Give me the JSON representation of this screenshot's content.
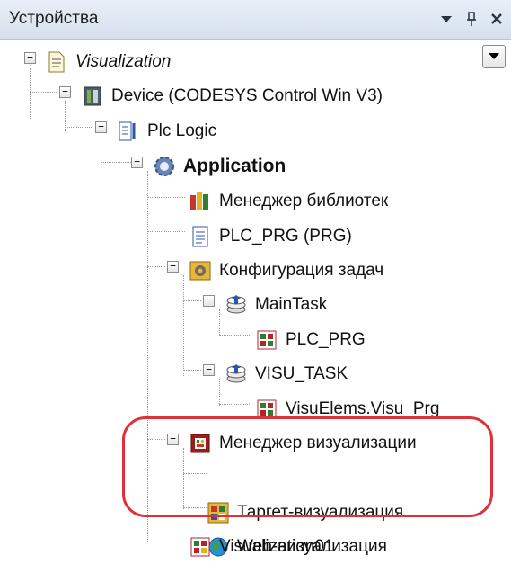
{
  "panel": {
    "title": "Устройства"
  },
  "tree": {
    "root": "Visualization",
    "device": "Device (CODESYS Control Win V3)",
    "plc_logic": "Plc Logic",
    "application": "Application",
    "library_manager": "Менеджер библиотек",
    "plc_prg": "PLC_PRG (PRG)",
    "task_config": "Конфигурация задач",
    "main_task": "MainTask",
    "main_task_call": "PLC_PRG",
    "visu_task": "VISU_TASK",
    "visu_task_call": "VisuElems.Visu_Prg",
    "visu_manager": "Менеджер визуализации",
    "target_visu": "Таргет-визуализация",
    "web_visu": "Web-визуализация",
    "visualization01": "Visualization01"
  },
  "colors": {
    "highlight": "#e0313a"
  }
}
